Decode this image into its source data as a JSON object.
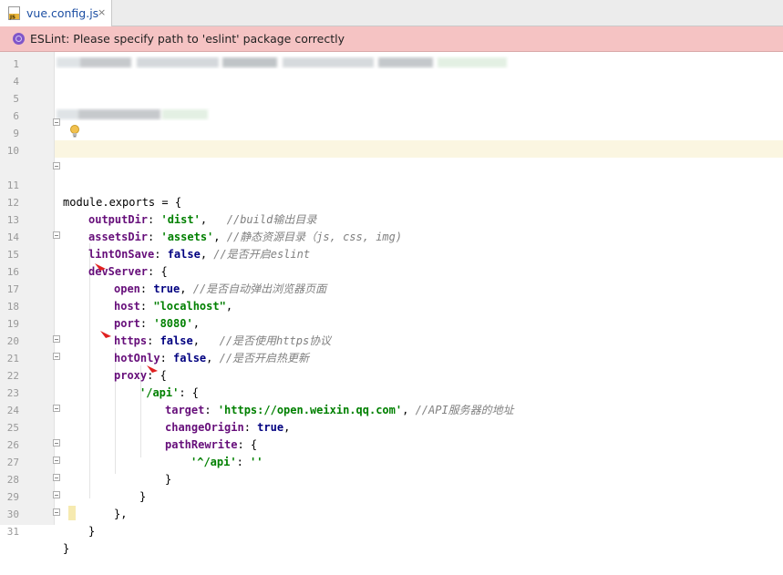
{
  "tab": {
    "filename": "vue.config.js",
    "file_icon": "js-file-icon",
    "close_glyph": "×"
  },
  "banner": {
    "message": "ESLint: Please specify path to 'eslint' package correctly",
    "icon": "eslint-icon"
  },
  "gutter": {
    "line_numbers": [
      "1",
      "4",
      "5",
      "6",
      "9",
      "10",
      "11",
      "12",
      "13",
      "14",
      "15",
      "16",
      "17",
      "18",
      "19",
      "20",
      "21",
      "22",
      "23",
      "24",
      "25",
      "26",
      "27",
      "28",
      "29",
      "30",
      "31"
    ]
  },
  "code": {
    "l11": {
      "a": "module.exports",
      "b": " = {"
    },
    "l12": {
      "key": "outputDir",
      "sep": ": ",
      "val": "'dist'",
      "tail": ",   ",
      "comment": "//build输出目录"
    },
    "l13": {
      "key": "assetsDir",
      "sep": ": ",
      "val": "'assets'",
      "tail": ", ",
      "comment": "//静态资源目录（js, css, img)"
    },
    "l14": {
      "key": "lintOnSave",
      "sep": ": ",
      "val": "false",
      "tail": ", ",
      "comment": "//是否开启eslint"
    },
    "l15": {
      "key": "devServer",
      "tail": ": {"
    },
    "l16": {
      "key": "open",
      "sep": ": ",
      "val": "true",
      "tail": ", ",
      "comment": "//是否自动弹出浏览器页面"
    },
    "l17": {
      "key": "host",
      "sep": ": ",
      "val": "\"localhost\"",
      "tail": ","
    },
    "l18": {
      "key": "port",
      "sep": ": ",
      "val": "'8080'",
      "tail": ","
    },
    "l19": {
      "key": "https",
      "sep": ": ",
      "val": "false",
      "tail": ",   ",
      "comment": "//是否使用https协议"
    },
    "l20": {
      "key": "hotOnly",
      "sep": ": ",
      "val": "false",
      "tail": ", ",
      "comment": "//是否开启热更新"
    },
    "l21": {
      "key": "proxy",
      "tail": ": {"
    },
    "l22": {
      "key": "'/api'",
      "tail": ": {"
    },
    "l23": {
      "key": "target",
      "sep": ": ",
      "val": "'https://open.weixin.qq.com'",
      "tail": ", ",
      "comment": "//API服务器的地址"
    },
    "l24": {
      "key": "changeOrigin",
      "sep": ": ",
      "val": "true",
      "tail": ","
    },
    "l25": {
      "key": "pathRewrite",
      "tail": ": {"
    },
    "l26": {
      "key": "'^/api'",
      "sep": ": ",
      "val": "''"
    },
    "l27": {
      "text": "}"
    },
    "l28": {
      "text": "}"
    },
    "l29": {
      "text": "},"
    },
    "l30": {
      "text": "}"
    },
    "l31": {
      "text": "}"
    }
  },
  "colors": {
    "banner_bg": "#f5c3c3",
    "keyword": "#000080",
    "property": "#660e7a",
    "string": "#008000",
    "comment": "#808080",
    "arrow": "#e02020"
  },
  "annotations": {
    "arrows": [
      "red-arrow-host",
      "red-arrow-proxy",
      "red-arrow-target"
    ],
    "blurred_lines": [
      1,
      6
    ]
  }
}
